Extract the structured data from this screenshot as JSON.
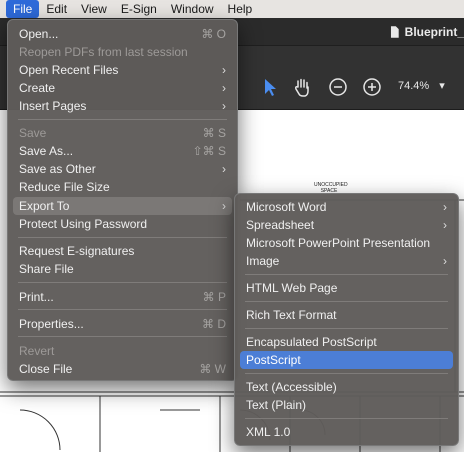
{
  "menubar": {
    "items": [
      "File",
      "Edit",
      "View",
      "E-Sign",
      "Window",
      "Help"
    ]
  },
  "document": {
    "tab_title": "Blueprint_",
    "plan_label": "UNOCCUPIED\nSPACE"
  },
  "toolbar": {
    "zoom": "74.4%",
    "zoom_arrow": "▾",
    "icons": [
      "pointer-icon",
      "hand-icon",
      "zoom-out-icon",
      "zoom-in-icon"
    ]
  },
  "file_menu": {
    "items": [
      {
        "label": "Open...",
        "shortcut": "⌘ O",
        "enabled": true
      },
      {
        "label": "Reopen PDFs from last session",
        "enabled": false
      },
      {
        "label": "Open Recent Files",
        "submenu": true,
        "enabled": true
      },
      {
        "label": "Create",
        "submenu": true,
        "enabled": true
      },
      {
        "label": "Insert Pages",
        "submenu": true,
        "enabled": true
      },
      {
        "label": "Save",
        "shortcut": "⌘ S",
        "enabled": false
      },
      {
        "label": "Save As...",
        "shortcut": "⇧⌘ S",
        "enabled": true
      },
      {
        "label": "Save as Other",
        "submenu": true,
        "enabled": true
      },
      {
        "label": "Reduce File Size",
        "enabled": true
      },
      {
        "label": "Export To",
        "submenu": true,
        "enabled": true,
        "highlighted": true
      },
      {
        "label": "Protect Using Password",
        "enabled": true
      },
      {
        "label": "Request E-signatures",
        "enabled": true
      },
      {
        "label": "Share File",
        "enabled": true
      },
      {
        "label": "Print...",
        "shortcut": "⌘ P",
        "enabled": true
      },
      {
        "label": "Properties...",
        "shortcut": "⌘ D",
        "enabled": true
      },
      {
        "label": "Revert",
        "enabled": false
      },
      {
        "label": "Close File",
        "shortcut": "⌘ W",
        "enabled": true
      }
    ]
  },
  "export_submenu": {
    "items": [
      {
        "label": "Microsoft Word",
        "submenu": true
      },
      {
        "label": "Spreadsheet",
        "submenu": true
      },
      {
        "label": "Microsoft PowerPoint Presentation"
      },
      {
        "label": "Image",
        "submenu": true
      },
      {
        "label": "HTML Web Page"
      },
      {
        "label": "Rich Text Format"
      },
      {
        "label": "Encapsulated PostScript"
      },
      {
        "label": "PostScript",
        "selected": true
      },
      {
        "label": "Text (Accessible)"
      },
      {
        "label": "Text (Plain)"
      },
      {
        "label": "XML 1.0"
      }
    ]
  },
  "chevron": "›",
  "colors": {
    "menu_bg": "#5f5c5a",
    "selection": "#4c7ed6",
    "menubar_active": "#2e6ad9"
  }
}
